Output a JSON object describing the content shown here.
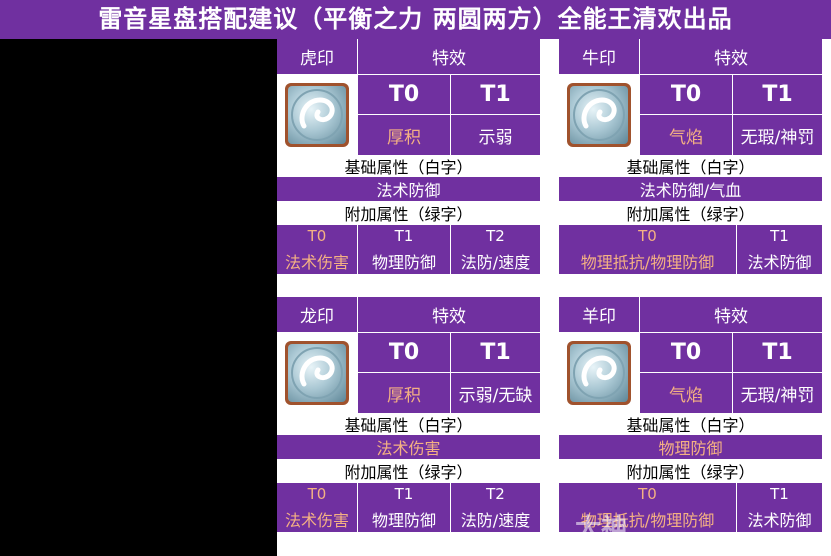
{
  "title": "雷音星盘搭配建议（平衡之力 两圆两方）全能王清欢出品",
  "labels": {
    "effect": "特效",
    "base": "基础属性（白字）",
    "extra": "附加属性（绿字）"
  },
  "blocks": [
    {
      "name": "虎印",
      "icon": "tiger-seal-icon",
      "t0": "T0",
      "t1": "T1",
      "t0_effect": "厚积",
      "t1_effect": "示弱",
      "base_value": "法术防御",
      "extra_tiers": [
        "T0",
        "T1",
        "T2"
      ],
      "extra_values": [
        "法术伤害",
        "物理防御",
        "法防/速度"
      ]
    },
    {
      "name": "牛印",
      "icon": "ox-seal-icon",
      "t0": "T0",
      "t1": "T1",
      "t0_effect": "气焰",
      "t1_effect": "无瑕/神罚",
      "base_value": "法术防御/气血",
      "extra_tiers": [
        "T0",
        "T1"
      ],
      "extra_values": [
        "物理抵抗/物理防御",
        "法术防御"
      ]
    },
    {
      "name": "龙印",
      "icon": "dragon-seal-icon",
      "t0": "T0",
      "t1": "T1",
      "t0_effect": "厚积",
      "t1_effect": "示弱/无缺",
      "base_value": "法术伤害",
      "extra_tiers": [
        "T0",
        "T1",
        "T2"
      ],
      "extra_values": [
        "法术伤害",
        "物理防御",
        "法防/速度"
      ]
    },
    {
      "name": "羊印",
      "icon": "ram-seal-icon",
      "t0": "T0",
      "t1": "T1",
      "t0_effect": "气焰",
      "t1_effect": "无瑕/神罚",
      "base_value": "物理防御",
      "extra_tiers": [
        "T0",
        "T1"
      ],
      "extra_values": [
        "物理抵抗/物理防御",
        "法术防御"
      ]
    }
  ],
  "watermark": "大神",
  "colors": {
    "header": "#7030a0",
    "highlight": "#f4b183",
    "frame": "#a0522d"
  }
}
